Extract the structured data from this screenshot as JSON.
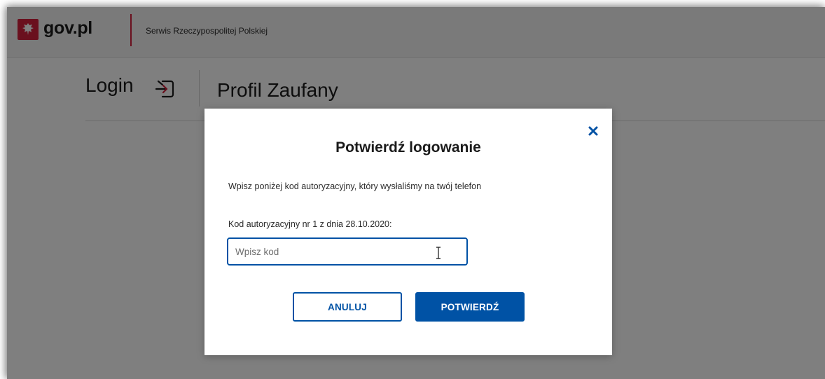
{
  "header": {
    "logo_text": "gov.pl",
    "logo_icon": "eagle-emblem-icon",
    "subtitle": "Serwis Rzeczypospolitej Polskiej"
  },
  "page": {
    "login_label": "Login",
    "login_icon": "login-arrow-icon",
    "title": "Profil Zaufany"
  },
  "modal": {
    "close_icon": "close-icon",
    "title": "Potwierdź logowanie",
    "description": "Wpisz poniżej kod autoryzacyjny, który wysłaliśmy na twój telefon",
    "code_label": "Kod autoryzacyjny nr 1 z dnia 28.10.2020:",
    "code_value": "",
    "code_placeholder": "Wpisz kod",
    "cancel_label": "ANULUJ",
    "confirm_label": "POTWIERDŹ"
  },
  "colors": {
    "brand_red": "#d4213d",
    "primary_blue": "#0052a5",
    "overlay": "rgba(0,0,0,0.50)"
  }
}
